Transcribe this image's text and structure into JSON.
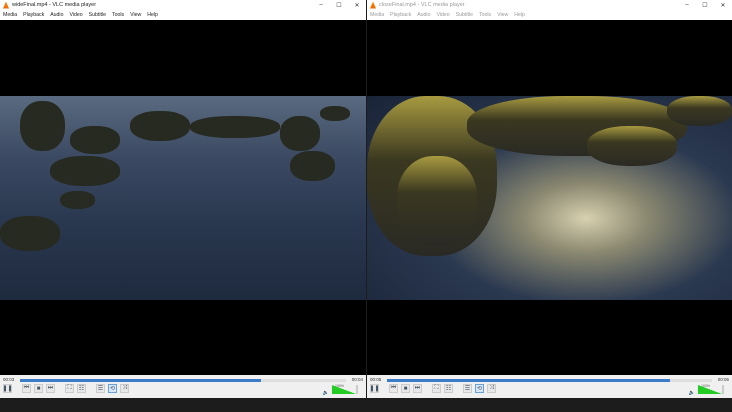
{
  "windows": [
    {
      "title": "wideFinal.mp4 - VLC media player",
      "elapsed": "00:03",
      "total": "00:04",
      "progress": 0.74,
      "volume": "100%"
    },
    {
      "title": "closeFinal.mp4 - VLC media player",
      "elapsed": "00:05",
      "total": "00:06",
      "progress": 0.87,
      "volume": "100%"
    }
  ],
  "menu": [
    "Media",
    "Playback",
    "Audio",
    "Video",
    "Subtitle",
    "Tools",
    "View",
    "Help"
  ],
  "window_controls": {
    "minimize": "–",
    "maximize": "☐",
    "close": "✕"
  },
  "controls": {
    "pause": "❚❚",
    "prev": "⏮",
    "stop": "■",
    "next": "⏭",
    "fullscreen": "⛶",
    "extended": "☷",
    "playlist": "☰",
    "loop": "⟲",
    "random": "⤨",
    "speaker": "🔈"
  }
}
